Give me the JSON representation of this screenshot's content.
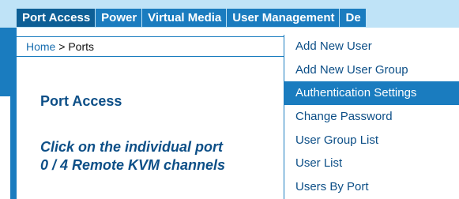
{
  "nav": {
    "items": [
      {
        "label": "Port Access"
      },
      {
        "label": "Power"
      },
      {
        "label": "Virtual Media"
      },
      {
        "label": "User Management"
      },
      {
        "label": "De"
      }
    ]
  },
  "breadcrumb": {
    "home": "Home",
    "separator": ">",
    "current": "Ports"
  },
  "main": {
    "title": "Port Access",
    "instruction_line1": "Click on the individual port",
    "instruction_line2": "0 / 4 Remote KVM channels"
  },
  "dropdown": {
    "items": [
      {
        "label": "Add New User"
      },
      {
        "label": "Add New User Group"
      },
      {
        "label": "Authentication Settings"
      },
      {
        "label": "Change Password"
      },
      {
        "label": "User Group List"
      },
      {
        "label": "User List"
      },
      {
        "label": "Users By Port"
      }
    ]
  },
  "colors": {
    "nav_background": "#1a7cbf",
    "nav_active": "#0d5f96",
    "top_bar": "#bfe3f7",
    "heading_text": "#0d4f87",
    "link": "#1a6fb0",
    "menu_highlight": "#1a7cbf"
  }
}
